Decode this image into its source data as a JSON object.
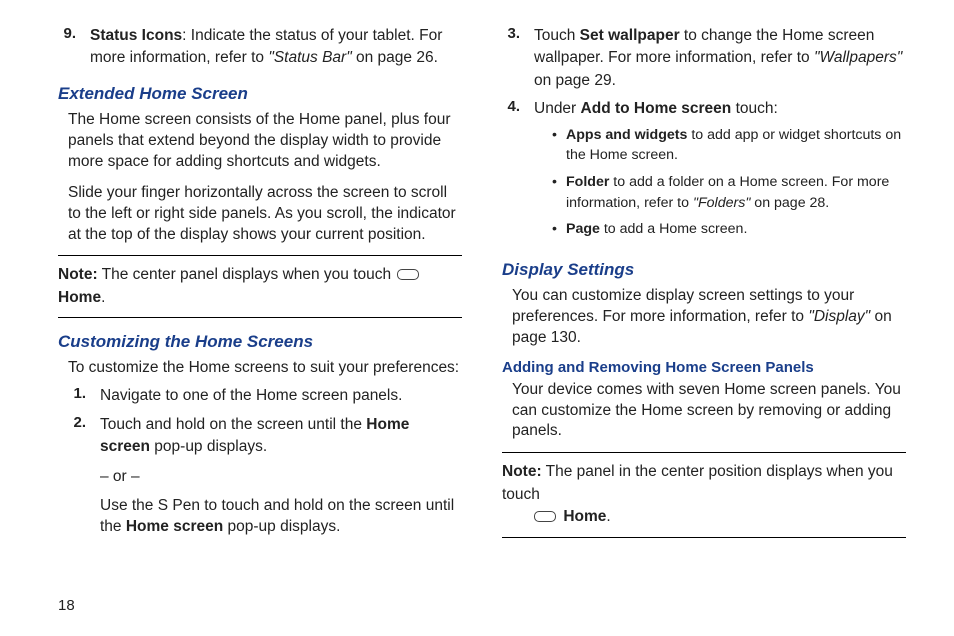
{
  "page_number": "18",
  "col1": {
    "item9": {
      "num": "9.",
      "lead": "Status Icons",
      "text1": ": Indicate the status of your tablet.  For more information, refer to ",
      "ref": "\"Status Bar\"",
      "text2": " on page 26."
    },
    "h_ext": "Extended Home Screen",
    "ext_p1": "The Home screen consists of the Home panel, plus four panels that extend beyond the display width to provide more space for adding shortcuts and widgets.",
    "ext_p2": "Slide your finger horizontally across the screen to scroll to the left or right side panels. As you scroll, the indicator at the top of the display shows your current position.",
    "note1_lead": "Note:",
    "note1_text1": " The center panel displays when you touch ",
    "note1_home": "Home",
    "h_custom": "Customizing the Home Screens",
    "custom_intro": "To customize the Home screens to suit your preferences:",
    "item1": {
      "num": "1.",
      "text": "Navigate to one of the Home screen panels."
    },
    "item2": {
      "num": "2.",
      "text1": "Touch and hold on the screen until the ",
      "bold1": "Home screen",
      "text2": " pop-up displays.",
      "or": "– or –",
      "text3": "Use the S Pen to touch and hold on the screen until the ",
      "bold2": "Home screen",
      "text4": " pop-up displays."
    }
  },
  "col2": {
    "item3": {
      "num": "3.",
      "text1": "Touch ",
      "bold1": "Set wallpaper",
      "text2": " to change the Home screen wallpaper. For more information, refer to ",
      "ref": "\"Wallpapers\"",
      "text3": " on page 29."
    },
    "item4": {
      "num": "4.",
      "text1": "Under ",
      "bold1": "Add to Home screen",
      "text2": " touch:"
    },
    "b1": {
      "bold": "Apps and widgets",
      "text": " to add app or widget shortcuts on the Home screen."
    },
    "b2": {
      "bold": "Folder",
      "text1": " to add a folder on a Home screen. For more information, refer to ",
      "ref": "\"Folders\"",
      "text2": " on page 28."
    },
    "b3": {
      "bold": "Page",
      "text": " to add a Home screen."
    },
    "h_display": "Display Settings",
    "disp_p1a": "You can customize display screen settings to your preferences. For more information, refer to ",
    "disp_ref": "\"Display\"",
    "disp_p1b": " on page 130.",
    "h_addremove": "Adding and Removing Home Screen Panels",
    "add_p1": "Your device comes with seven Home screen panels. You can customize the Home screen by removing or adding panels.",
    "note2_lead": "Note:",
    "note2_text": " The panel in the center position displays when you touch ",
    "note2_home": "Home"
  }
}
